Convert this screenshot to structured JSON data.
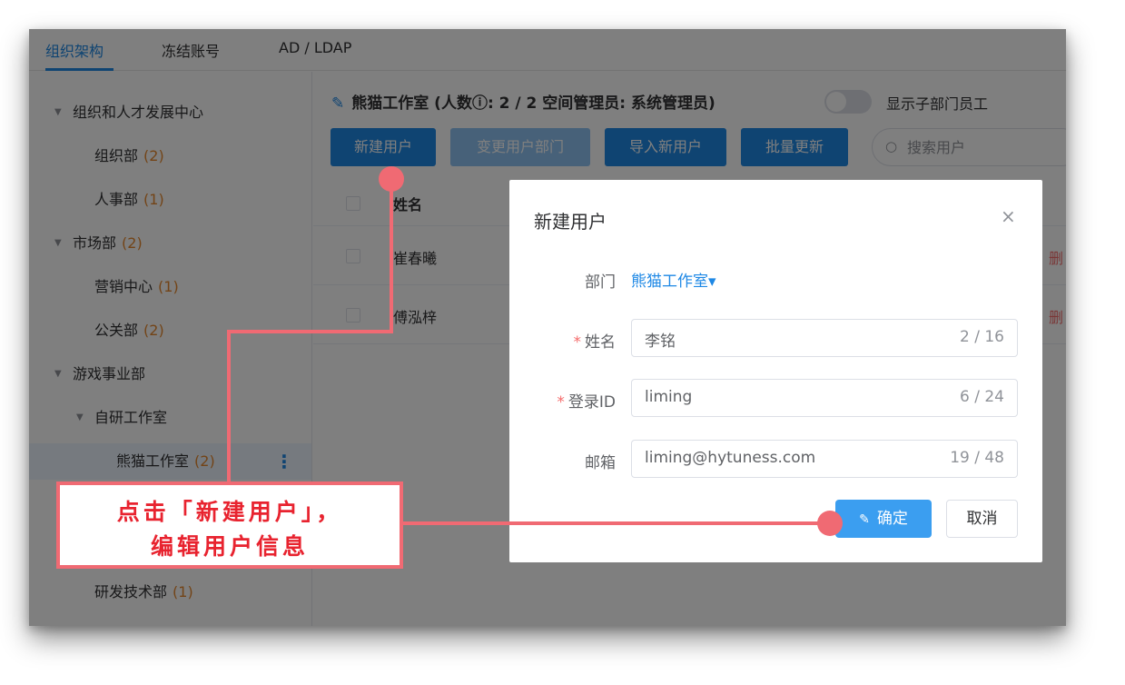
{
  "tabs": [
    "组织架构",
    "冻结账号",
    "AD / LDAP"
  ],
  "sidebar": {
    "items": [
      {
        "label": "组织和人才发展中心",
        "count": ""
      },
      {
        "label": "组织部",
        "count": "(2)"
      },
      {
        "label": "人事部",
        "count": "(1)"
      },
      {
        "label": "市场部",
        "count": "(2)"
      },
      {
        "label": "营销中心",
        "count": "(1)"
      },
      {
        "label": "公关部",
        "count": "(2)"
      },
      {
        "label": "游戏事业部",
        "count": ""
      },
      {
        "label": "自研工作室",
        "count": ""
      },
      {
        "label": "熊猫工作室",
        "count": "(2)"
      },
      {
        "label": "研发技术部",
        "count": "(1)"
      }
    ],
    "more_icon": "vertical-dots-icon"
  },
  "main": {
    "header": "熊猫工作室 (人数ⓘ: 2 / 2  空间管理员: 系统管理员)",
    "toggle_label": "显示子部门员工",
    "buttons": [
      "新建用户",
      "变更用户部门",
      "导入新用户",
      "批量更新"
    ],
    "search_placeholder": "搜索用户",
    "table": {
      "header_name": "姓名",
      "rows": [
        {
          "name": "崔春曦",
          "action": "删"
        },
        {
          "name": "傅泓梓",
          "action": "删"
        }
      ]
    }
  },
  "dialog": {
    "title": "新建用户",
    "close": "×",
    "dept_label": "部门",
    "dept_value": "熊猫工作室▾",
    "required_mark": "*",
    "name_label": "姓名",
    "name_value": "李铭",
    "name_count": "2 / 16",
    "login_label": "登录ID",
    "login_value": "liming",
    "login_count": "6 / 24",
    "email_label": "邮箱",
    "email_value": "liming@hytuness.com",
    "email_count": "19 / 48",
    "confirm_icon": "edit-icon",
    "confirm": "确定",
    "cancel": "取消"
  },
  "callout": {
    "line1": "点击「新建用户」，",
    "line2": "编辑用户信息"
  },
  "colors": {
    "accent": "#1e88e5",
    "annotation": "#f06a73",
    "annotation_text": "#e8232f",
    "count": "#e6892f",
    "danger": "#f56c6c"
  }
}
